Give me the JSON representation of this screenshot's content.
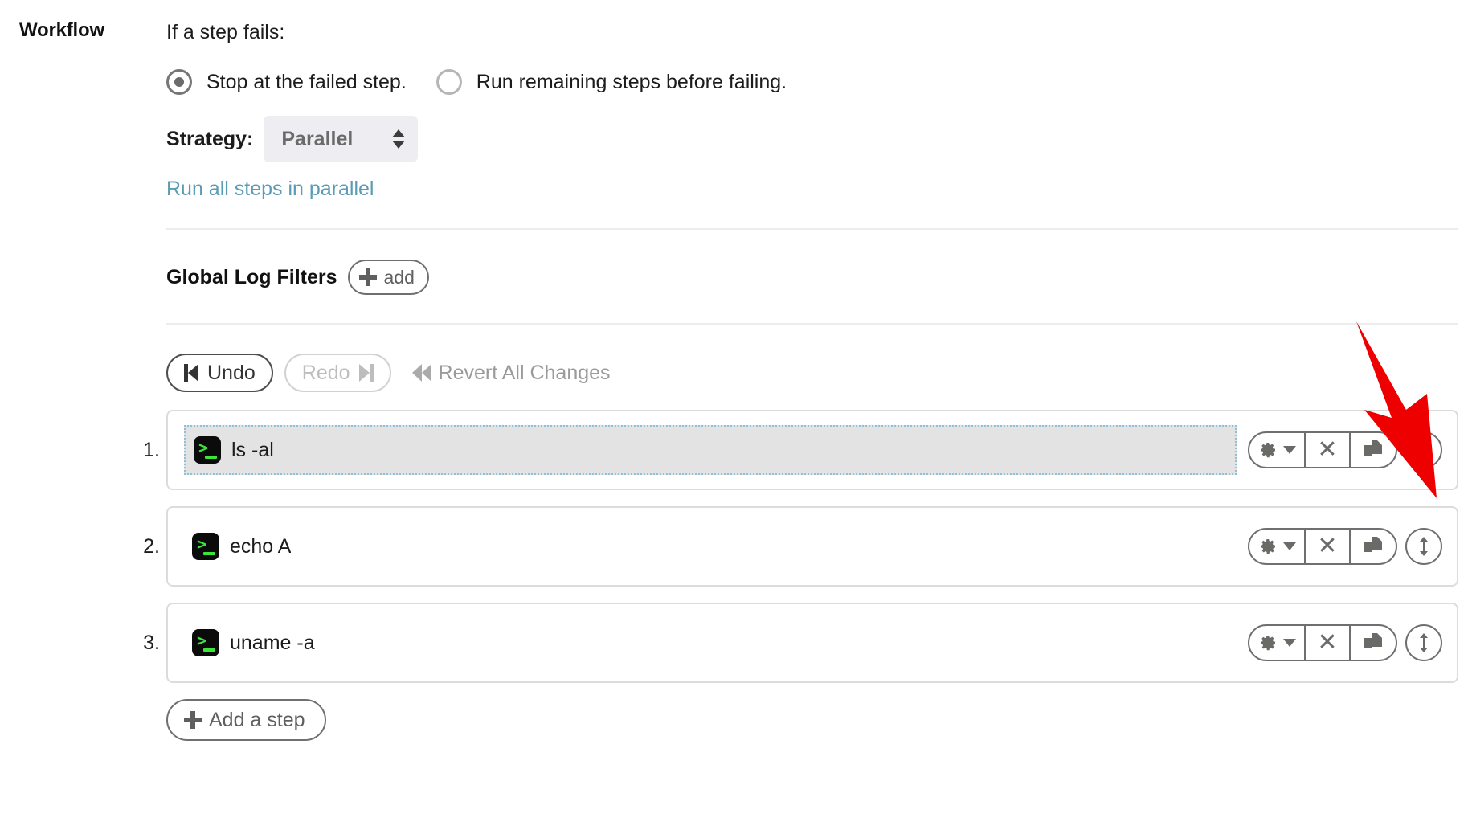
{
  "section": {
    "label": "Workflow"
  },
  "failure": {
    "prompt": "If a step fails:",
    "options": [
      {
        "label": "Stop at the failed step.",
        "selected": true
      },
      {
        "label": "Run remaining steps before failing.",
        "selected": false
      }
    ]
  },
  "strategy": {
    "label": "Strategy:",
    "value": "Parallel",
    "hint_link": "Run all steps in parallel",
    "link_color": "#5b9bb5"
  },
  "global_log_filters": {
    "title": "Global Log Filters",
    "add_label": "add"
  },
  "history_toolbar": {
    "undo_label": "Undo",
    "redo_label": "Redo",
    "revert_label": "Revert All Changes",
    "undo_enabled": true,
    "redo_enabled": false
  },
  "steps": [
    {
      "number": "1.",
      "command": "ls -al",
      "selected": true
    },
    {
      "number": "2.",
      "command": "echo A",
      "selected": false
    },
    {
      "number": "3.",
      "command": "uname -a",
      "selected": false
    }
  ],
  "step_actions": {
    "settings": "gear-dropdown",
    "remove": "delete",
    "duplicate": "duplicate",
    "reorder": "drag-reorder"
  },
  "add_step": {
    "label": "Add a step"
  },
  "annotation": {
    "type": "arrow",
    "color": "#ee0000",
    "points_at": "reorder-drag-handle-step-1"
  }
}
